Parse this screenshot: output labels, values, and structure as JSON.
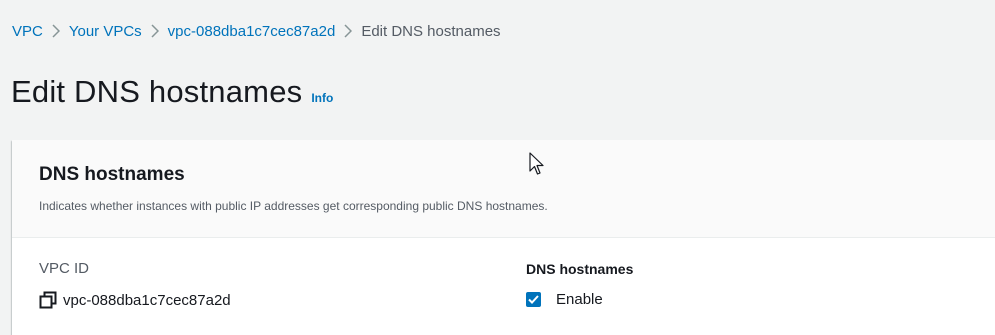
{
  "breadcrumb": {
    "items": [
      {
        "label": "VPC",
        "link": true
      },
      {
        "label": "Your VPCs",
        "link": true
      },
      {
        "label": "vpc-088dba1c7cec87a2d",
        "link": true
      },
      {
        "label": "Edit DNS hostnames",
        "link": false
      }
    ]
  },
  "header": {
    "title": "Edit DNS hostnames",
    "info_label": "Info"
  },
  "section": {
    "title": "DNS hostnames",
    "description": "Indicates whether instances with public IP addresses get corresponding public DNS hostnames."
  },
  "fields": {
    "vpc_id_label": "VPC ID",
    "vpc_id_value": "vpc-088dba1c7cec87a2d",
    "dns_hostnames_label": "DNS hostnames",
    "enable_label": "Enable",
    "enable_checked": true
  },
  "icons": {
    "separator": "chevron-right-icon",
    "copy": "copy-icon",
    "check": "check-icon",
    "cursor": "mouse-pointer-icon"
  },
  "colors": {
    "link": "#0073bb",
    "background": "#f2f3f3",
    "checkbox": "#0073bb"
  }
}
